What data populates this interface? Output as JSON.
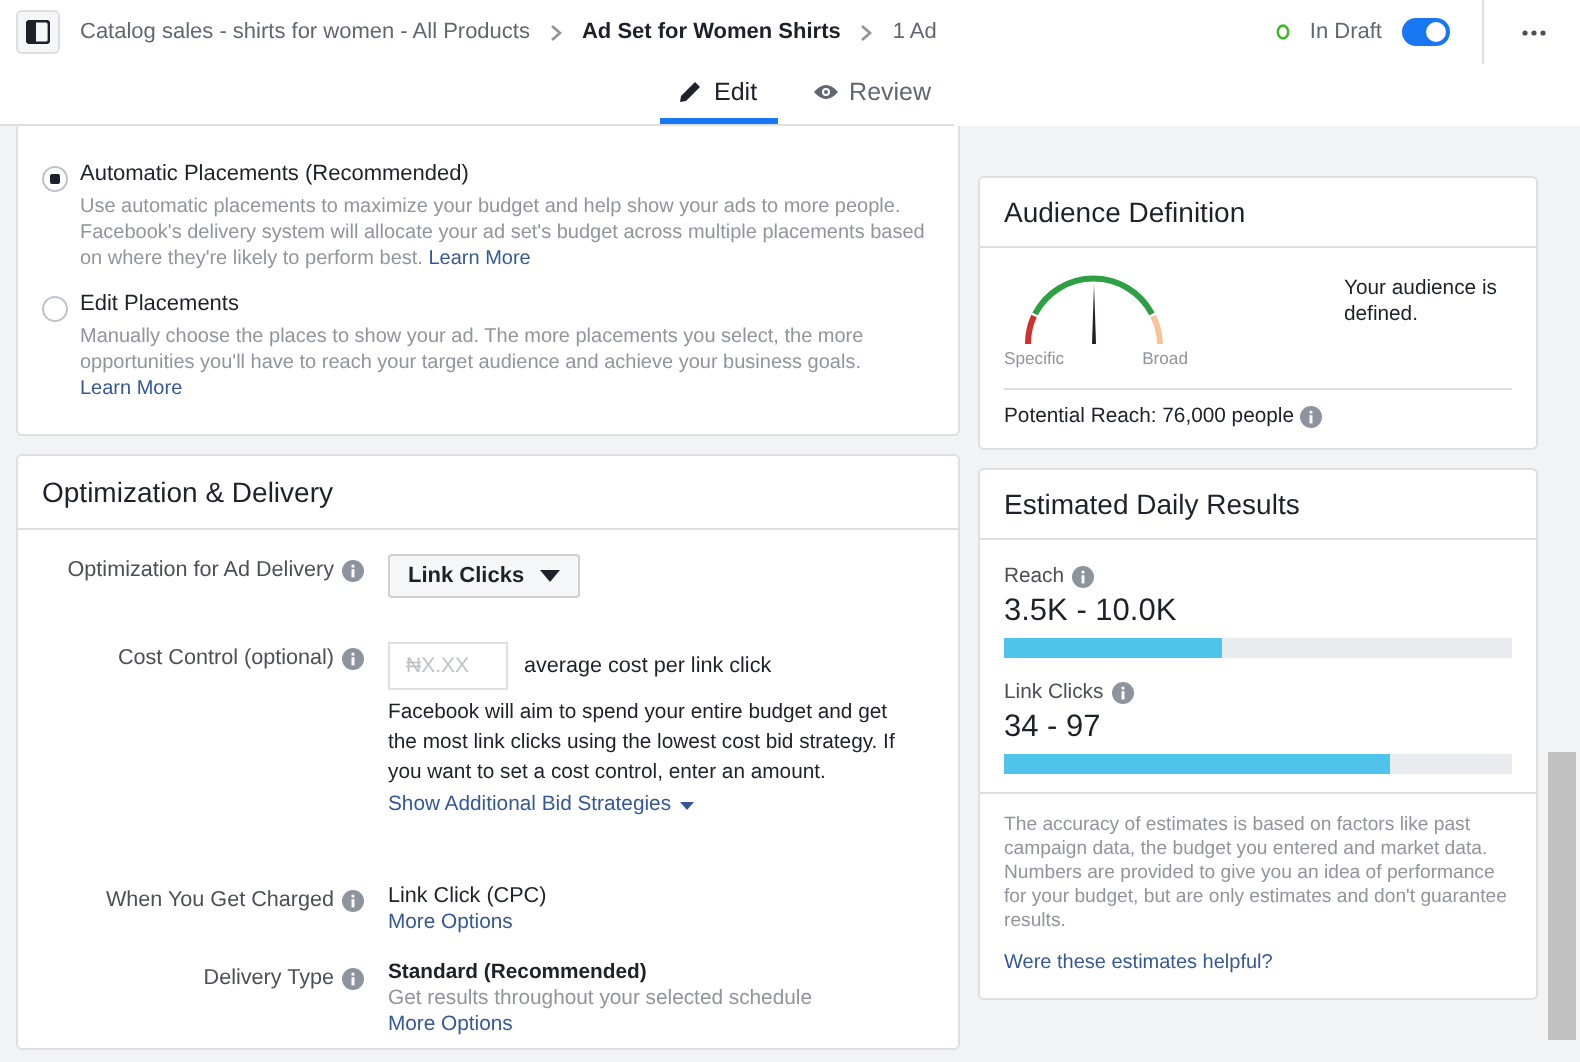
{
  "top_bar": {
    "breadcrumbs": [
      {
        "label": "Catalog sales - shirts for women - All Products",
        "current": false
      },
      {
        "label": "Ad Set for Women Shirts",
        "current": true
      },
      {
        "label": "1 Ad",
        "current": false
      }
    ],
    "status": "In Draft",
    "toggle_on": true
  },
  "tabs": [
    {
      "label": "Edit",
      "selected": true
    },
    {
      "label": "Review",
      "selected": false
    }
  ],
  "placements": {
    "options": [
      {
        "label": "Automatic Placements (Recommended)",
        "selected": true,
        "description": "Use automatic placements to maximize your budget and help show your ads to more people. Facebook's delivery system will allocate your ad set's budget across multiple placements based on where they're likely to perform best.",
        "link": "Learn More"
      },
      {
        "label": "Edit Placements",
        "selected": false,
        "description": "Manually choose the places to show your ad. The more placements you select, the more opportunities you'll have to reach your target audience and achieve your business goals.",
        "link": "Learn More"
      }
    ]
  },
  "optimization": {
    "title": "Optimization & Delivery",
    "rows": [
      {
        "kind": "dropdown",
        "label": "Optimization for Ad Delivery",
        "value": "Link Clicks"
      },
      {
        "kind": "cost",
        "label": "Cost Control (optional)",
        "placeholder": "₦X.XX",
        "suffix": "average cost per link click",
        "description": "Facebook will aim to spend your entire budget and get the most link clicks using the lowest cost bid strategy. If you want to set a cost control, enter an amount.",
        "link": "Show Additional Bid Strategies"
      },
      {
        "kind": "text",
        "label": "When You Get Charged",
        "value": "Link Click (CPC)",
        "link": "More Options"
      },
      {
        "kind": "text",
        "label": "Delivery Type",
        "value": "Standard (Recommended)",
        "description": "Get results throughout your selected schedule",
        "link": "More Options"
      }
    ]
  },
  "audience": {
    "title": "Audience Definition",
    "gauge_left": "Specific",
    "gauge_right": "Broad",
    "message": "Your audience is defined.",
    "potential_reach": "Potential Reach: 76,000 people"
  },
  "estimates": {
    "title": "Estimated Daily Results",
    "metrics": [
      {
        "label": "Reach",
        "value": "3.5K - 10.0K",
        "level": 0.43
      },
      {
        "label": "Link Clicks",
        "value": "34 - 97",
        "level": 0.76
      }
    ],
    "note": "The accuracy of estimates is based on factors like past campaign data, the budget you entered and market data. Numbers are provided to give you an idea of performance for your budget, but are only estimates and don't guarantee results.",
    "link": "Were these estimates helpful?"
  }
}
